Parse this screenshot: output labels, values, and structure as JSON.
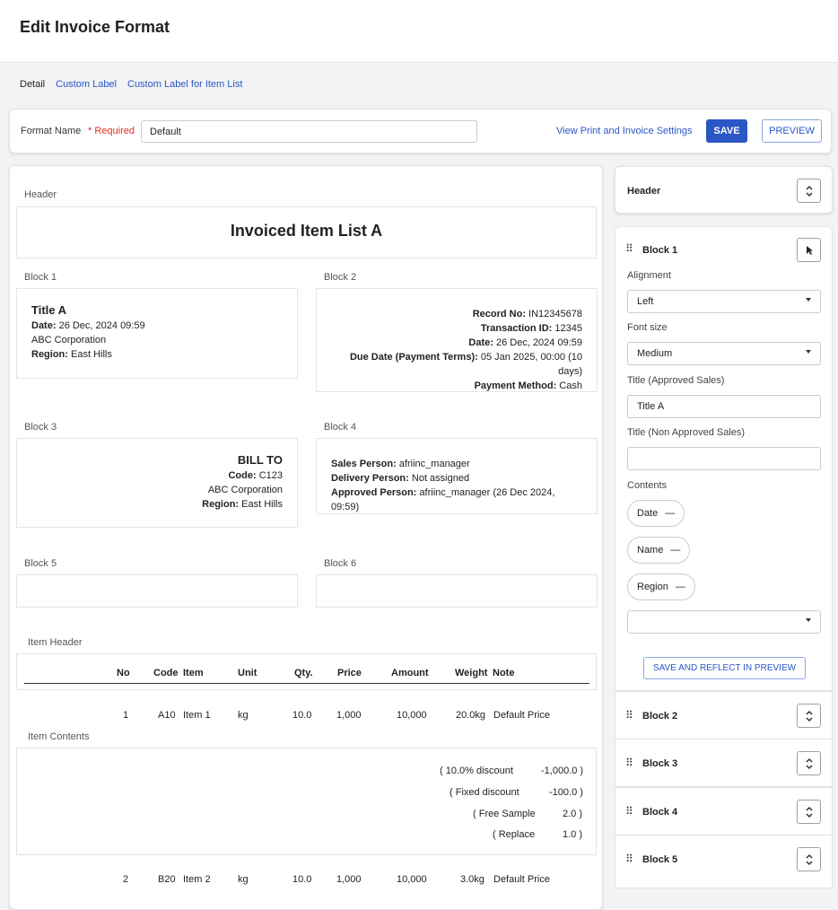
{
  "page": {
    "title": "Edit Invoice Format"
  },
  "tabs": [
    {
      "label": "Detail",
      "active": true
    },
    {
      "label": "Custom Label",
      "active": false
    },
    {
      "label": "Custom Label for Item List",
      "active": false
    }
  ],
  "format_bar": {
    "label": "Format Name",
    "required": "* Required",
    "value": "Default",
    "settings_link": "View Print and Invoice Settings",
    "save_label": "SAVE",
    "preview_label": "PREVIEW"
  },
  "preview": {
    "header_label": "Header",
    "header_title": "Invoiced Item List A",
    "block1": {
      "label": "Block 1",
      "title": "Title A",
      "date_key": "Date:",
      "date_val": " 26 Dec, 2024 09:59",
      "company": "ABC Corporation",
      "region_key": "Region:",
      "region_val": " East Hills"
    },
    "block2": {
      "label": "Block 2",
      "record_key": "Record No:",
      "record_val": " IN12345678",
      "txn_key": "Transaction ID:",
      "txn_val": " 12345",
      "date_key": "Date:",
      "date_val": " 26 Dec, 2024 09:59",
      "due_key": "Due Date (Payment Terms):",
      "due_val": " 05 Jan 2025, 00:00 (10 days)",
      "pay_key": "Payment Method:",
      "pay_val": " Cash"
    },
    "block3": {
      "label": "Block 3",
      "title": "BILL TO",
      "code_key": "Code:",
      "code_val": " C123",
      "company": "ABC Corporation",
      "region_key": "Region:",
      "region_val": " East Hills"
    },
    "block4": {
      "label": "Block 4",
      "sales_key": "Sales Person:",
      "sales_val": " afriinc_manager",
      "delivery_key": "Delivery Person:",
      "delivery_val": " Not assigned",
      "approved_key": "Approved Person:",
      "approved_val": " afriinc_manager (26 Dec 2024, 09:59)"
    },
    "block5": {
      "label": "Block 5"
    },
    "block6": {
      "label": "Block 6"
    },
    "item_header_label": "Item Header",
    "item_contents_label": "Item Contents",
    "columns": [
      "No",
      "Code",
      "Item",
      "Unit",
      "Qty.",
      "Price",
      "Amount",
      "Weight",
      "Note"
    ],
    "rows": [
      {
        "no": "1",
        "code": "A10",
        "item": "Item 1",
        "unit": "kg",
        "qty": "10.0",
        "price": "1,000",
        "amount": "10,000",
        "weight": "20.0kg",
        "note": "Default Price"
      },
      {
        "no": "2",
        "code": "B20",
        "item": "Item 2",
        "unit": "kg",
        "qty": "10.0",
        "price": "1,000",
        "amount": "10,000",
        "weight": "3.0kg",
        "note": "Default Price"
      }
    ],
    "adjustments": [
      {
        "label": "( 10.0% discount",
        "value": "-1,000.0 )"
      },
      {
        "label": "( Fixed discount",
        "value": "-100.0 )"
      },
      {
        "label": "( Free Sample",
        "value": "2.0 )"
      },
      {
        "label": "( Replace",
        "value": "1.0 )"
      }
    ]
  },
  "side": {
    "header_title": "Header",
    "block1": {
      "title": "Block 1",
      "alignment_label": "Alignment",
      "alignment_value": "Left",
      "font_size_label": "Font size",
      "font_size_value": "Medium",
      "title_approved_label": "Title (Approved Sales)",
      "title_approved_value": "Title A",
      "title_non_approved_label": "Title (Non Approved Sales)",
      "title_non_approved_value": "",
      "contents_label": "Contents",
      "chips": [
        "Date",
        "Name",
        "Region"
      ],
      "chip_remove": "—",
      "reflect_label": "SAVE AND REFLECT IN PREVIEW"
    },
    "blocks": [
      "Block 2",
      "Block 3",
      "Block 4",
      "Block 5"
    ]
  },
  "icons": {
    "drag": "drag-handle-icon",
    "chevron": "unfold-icon"
  },
  "colors": {
    "accent": "#2a56c6",
    "required": "#d93025"
  }
}
